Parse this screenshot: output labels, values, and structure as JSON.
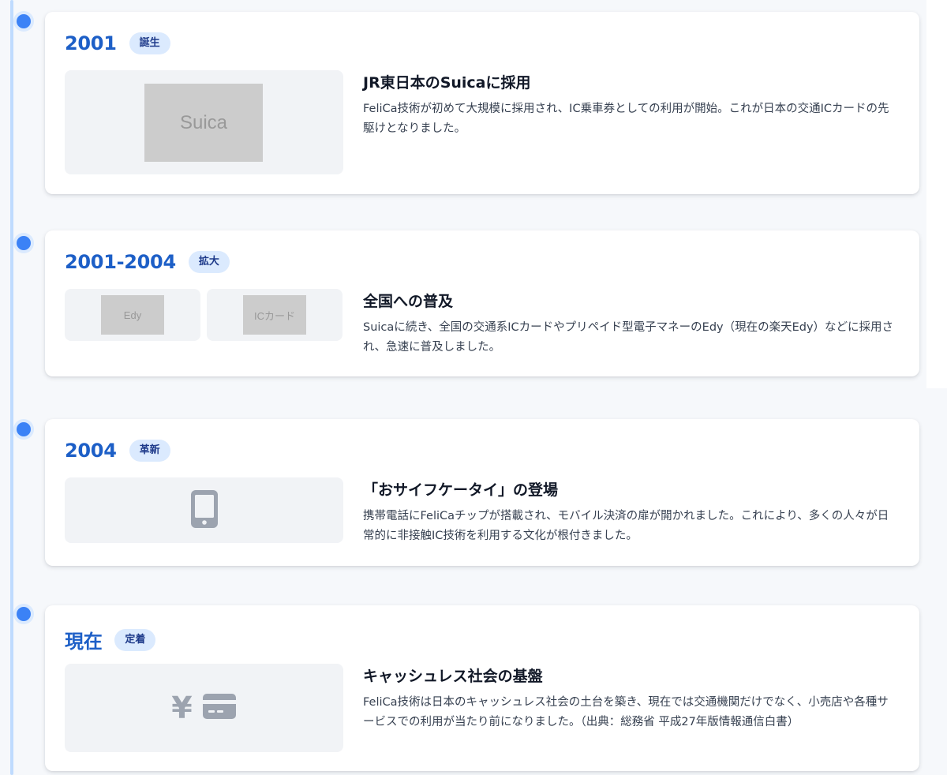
{
  "timeline": [
    {
      "year": "2001",
      "badge": "誕生",
      "heading": "JR東日本のSuicaに採用",
      "body": "FeliCa技術が初めて大規模に採用され、IC乗車券としての利用が開始。これが日本の交通ICカードの先駆けとなりました。",
      "image_labels": [
        "Suica"
      ]
    },
    {
      "year": "2001-2004",
      "badge": "拡大",
      "heading": "全国への普及",
      "body": "Suicaに続き、全国の交通系ICカードやプリペイド型電子マネーのEdy（現在の楽天Edy）などに採用され、急速に普及しました。",
      "image_labels": [
        "Edy",
        "ICカード"
      ]
    },
    {
      "year": "2004",
      "badge": "革新",
      "heading": "「おサイフケータイ」の登場",
      "body": "携帯電話にFeliCaチップが搭載され、モバイル決済の扉が開かれました。これにより、多くの人々が日常的に非接触IC技術を利用する文化が根付きました。",
      "icons": [
        "mobile-phone-icon"
      ]
    },
    {
      "year": "現在",
      "badge": "定着",
      "heading": "キャッシュレス社会の基盤",
      "body": "FeliCa技術は日本のキャッシュレス社会の土台を築き、現在では交通機関だけでなく、小売店や各種サービスでの利用が当たり前になりました。（出典：総務省 平成27年版情報通信白書）",
      "icons": [
        "yen-icon",
        "credit-card-icon"
      ],
      "yen_symbol": "¥"
    }
  ],
  "colors": {
    "accent": "#1d5fc7",
    "dot": "#3b82f6",
    "line": "#bfdbfe",
    "badge_bg": "#dbeafe",
    "icon_gray": "#9ca3af"
  }
}
